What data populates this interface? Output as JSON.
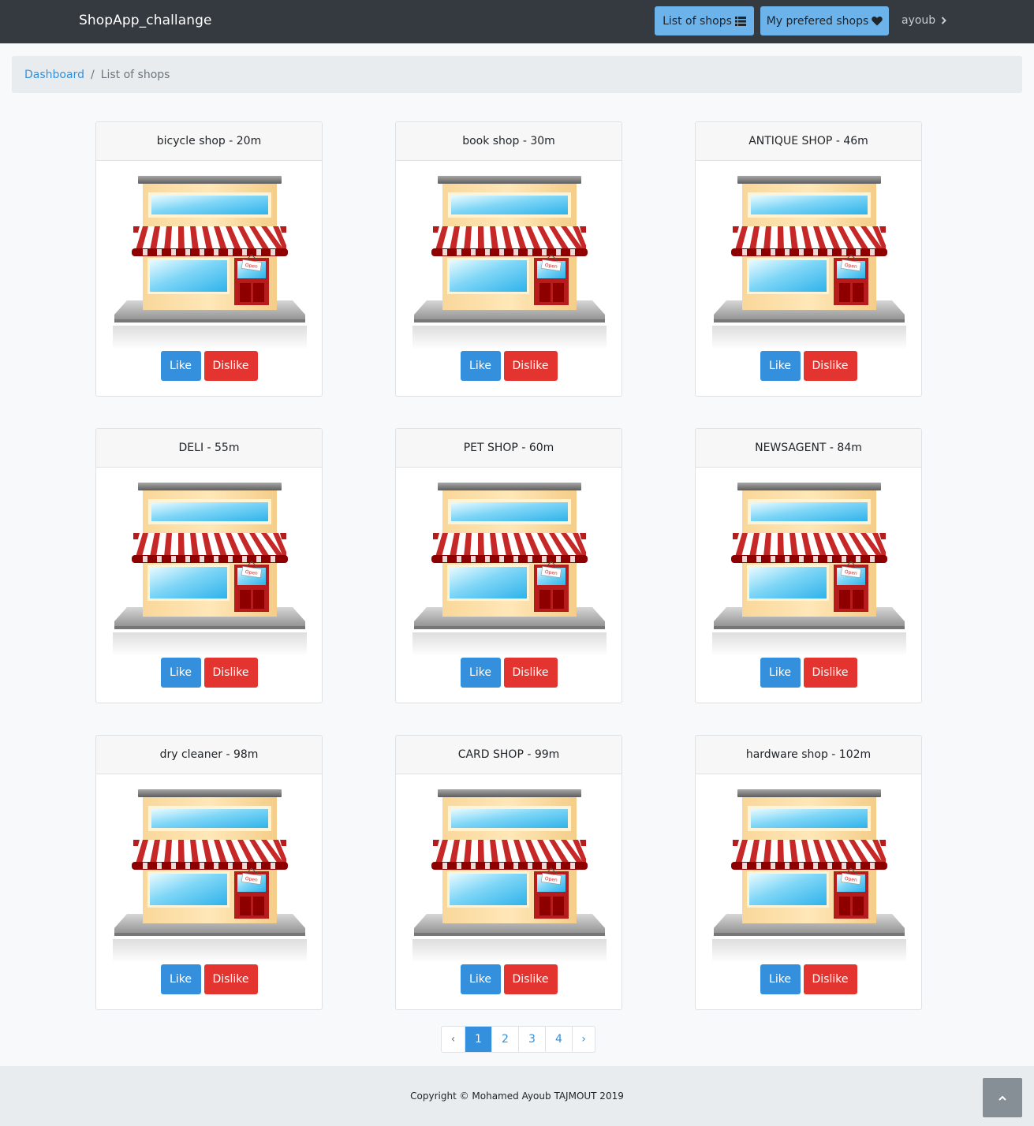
{
  "navbar": {
    "brand": "ShopApp_challange",
    "shops_button_label": "List of shops",
    "preferred_button_label": "My prefered shops",
    "username": "ayoub"
  },
  "breadcrumb": {
    "home": "Dashboard",
    "separator": "/",
    "current": "List of shops"
  },
  "shops": [
    {
      "title": "bicycle shop - 20m",
      "like": "Like",
      "dislike": "Dislike"
    },
    {
      "title": "book shop - 30m",
      "like": "Like",
      "dislike": "Dislike"
    },
    {
      "title": "ANTIQUE SHOP - 46m",
      "like": "Like",
      "dislike": "Dislike"
    },
    {
      "title": "DELI - 55m",
      "like": "Like",
      "dislike": "Dislike"
    },
    {
      "title": "PET SHOP - 60m",
      "like": "Like",
      "dislike": "Dislike"
    },
    {
      "title": "NEWSAGENT - 84m",
      "like": "Like",
      "dislike": "Dislike"
    },
    {
      "title": "dry cleaner - 98m",
      "like": "Like",
      "dislike": "Dislike"
    },
    {
      "title": "CARD SHOP - 99m",
      "like": "Like",
      "dislike": "Dislike"
    },
    {
      "title": "hardware shop - 102m",
      "like": "Like",
      "dislike": "Dislike"
    }
  ],
  "pagination": {
    "prev": "‹",
    "pages": [
      "1",
      "2",
      "3",
      "4"
    ],
    "current": "1",
    "next": "›"
  },
  "footer": {
    "copyright": "Copyright © Mohamed Ayoub TAJMOUT 2019"
  },
  "icons": {
    "list": "list-icon",
    "heart": "heart-icon",
    "chevron": "chevron-right-icon",
    "scroll_top": "chevron-up-icon"
  },
  "colors": {
    "navbar": "#343a40",
    "primary": "#3490dc",
    "danger": "#e3342f",
    "info": "#6cb2eb"
  }
}
